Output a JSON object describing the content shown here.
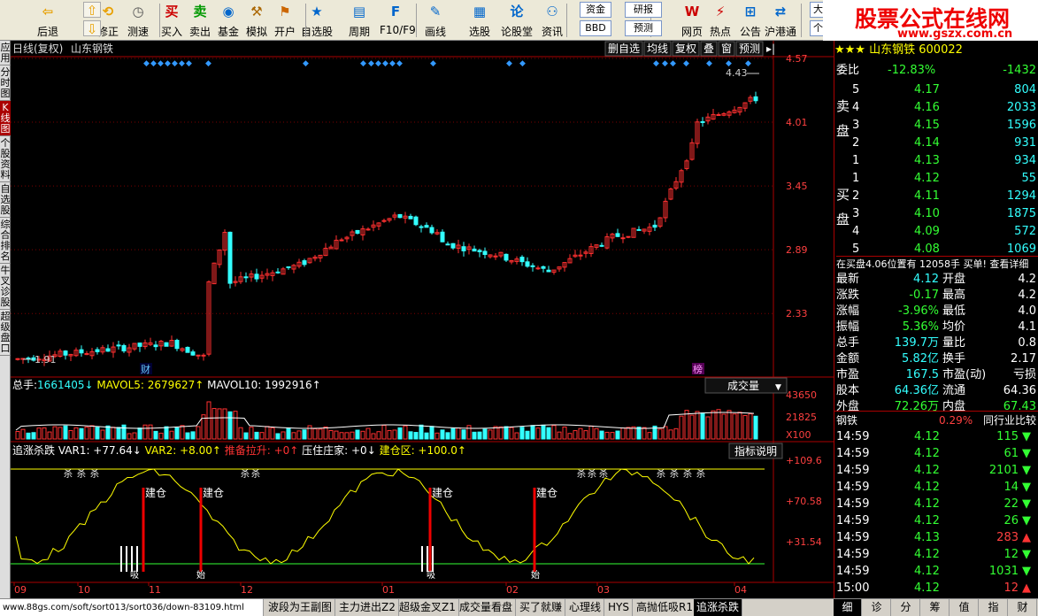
{
  "toolbar": {
    "items": [
      {
        "label": "后退",
        "icon": "back-arrow-icon"
      },
      {
        "label": "修正",
        "icon": "revise-icon"
      },
      {
        "label": "测速",
        "icon": "speed-test-icon"
      },
      {
        "label": "买入",
        "icon": "buy-icon"
      },
      {
        "label": "卖出",
        "icon": "sell-icon"
      },
      {
        "label": "基金",
        "icon": "fund-icon"
      },
      {
        "label": "模拟",
        "icon": "simulate-icon"
      },
      {
        "label": "开户",
        "icon": "open-account-icon"
      },
      {
        "label": "自选股",
        "icon": "watchlist-icon"
      },
      {
        "label": "周期",
        "icon": "period-icon"
      },
      {
        "label": "F10/F9",
        "icon": "f10-icon"
      },
      {
        "label": "画线",
        "icon": "draw-line-icon"
      },
      {
        "label": "选股",
        "icon": "stock-select-icon"
      },
      {
        "label": "论股堂",
        "icon": "forum-icon"
      },
      {
        "label": "资讯",
        "icon": "news-icon"
      },
      {
        "label": "网页",
        "icon": "web-icon"
      },
      {
        "label": "热点",
        "icon": "hotspot-icon"
      },
      {
        "label": "公告",
        "icon": "notice-icon"
      },
      {
        "label": "沪港通",
        "icon": "hk-connect-icon"
      }
    ],
    "zijin": "资金",
    "bbd": "BBD",
    "yanbao": "研报",
    "yuce": "预测",
    "dapan": "大盘",
    "gaban": "个股"
  },
  "brand": {
    "title": "股票公式在线网",
    "url": "www.gszx.com.cn"
  },
  "left_tabs": [
    "应用",
    "分时图",
    "K线图",
    "个股资料",
    "自选股",
    "综合排名",
    "牛叉诊股",
    "超级盘口"
  ],
  "chart": {
    "header": {
      "period": "日线(复权)",
      "name": "山东钢铁"
    },
    "header_buttons": [
      "删自选",
      "均线",
      "复权",
      "叠",
      "窗",
      "预测"
    ],
    "price_axis": [
      "4.57",
      "4.01",
      "3.45",
      "2.89",
      "2.33"
    ],
    "high_label": "4.43",
    "low_label": "1.91",
    "cai_label": "财",
    "bang_label": "榜",
    "volume": {
      "total_label": "总手:",
      "total": "1661405",
      "mavol5_label": "MAVOL5:",
      "mavol5": "2679627",
      "mavol10_label": "MAVOL10:",
      "mavol10": "1992916",
      "dropdown": "成交量",
      "axis": [
        "43650",
        "21825",
        "X100"
      ]
    },
    "indicator": {
      "name": "追涨杀跌",
      "var1": "VAR1: +77.64",
      "var2": "VAR2: +8.00",
      "jiala": "推备拉升: +0",
      "yazhu": "压住庄家: +0",
      "jiancang": "建仓区: +100.0",
      "button": "指标说明",
      "axis": [
        "+109.6",
        "+70.58",
        "+31.54"
      ],
      "jian_label": "建仓",
      "xi_label": "吸",
      "shi_label": "始",
      "sha_label": "杀"
    },
    "x_axis": [
      "09",
      "10",
      "11",
      "12",
      "01",
      "02",
      "03",
      "04"
    ]
  },
  "right": {
    "title": "山东钢铁",
    "code": "600022",
    "weibi": {
      "label": "委比",
      "pct": "-12.83%",
      "diff": "-1432"
    },
    "sell_label": "卖盘",
    "buy_label": "买盘",
    "sells": [
      {
        "lvl": "5",
        "price": "4.17",
        "vol": "804"
      },
      {
        "lvl": "4",
        "price": "4.16",
        "vol": "2033"
      },
      {
        "lvl": "3",
        "price": "4.15",
        "vol": "1596"
      },
      {
        "lvl": "2",
        "price": "4.14",
        "vol": "931"
      },
      {
        "lvl": "1",
        "price": "4.13",
        "vol": "934"
      }
    ],
    "buys": [
      {
        "lvl": "1",
        "price": "4.12",
        "vol": "55"
      },
      {
        "lvl": "2",
        "price": "4.11",
        "vol": "1294"
      },
      {
        "lvl": "3",
        "price": "4.10",
        "vol": "1875"
      },
      {
        "lvl": "4",
        "price": "4.09",
        "vol": "572"
      },
      {
        "lvl": "5",
        "price": "4.08",
        "vol": "1069"
      }
    ],
    "notice": "在买盘4.06位置有 12058手 买单! 查看详细",
    "stats": [
      [
        "最新",
        "4.12",
        "开盘",
        "4.2"
      ],
      [
        "涨跌",
        "-0.17",
        "最高",
        "4.2"
      ],
      [
        "涨幅",
        "-3.96%",
        "最低",
        "4.0"
      ],
      [
        "振幅",
        "5.36%",
        "均价",
        "4.1"
      ],
      [
        "总手",
        "139.7万",
        "量比",
        "0.8"
      ],
      [
        "金额",
        "5.82亿",
        "换手",
        "2.17"
      ],
      [
        "市盈",
        "167.5",
        "市盈(动)",
        "亏损"
      ],
      [
        "股本",
        "64.36亿",
        "流通",
        "64.36"
      ],
      [
        "外盘",
        "72.26万",
        "内盘",
        "67.43"
      ]
    ],
    "industry": {
      "name": "钢铁",
      "pct": "0.29%",
      "btn": "同行业比较"
    },
    "ticks": [
      {
        "t": "14:59",
        "p": "4.12",
        "v": "115",
        "d": "down"
      },
      {
        "t": "14:59",
        "p": "4.12",
        "v": "61",
        "d": "down"
      },
      {
        "t": "14:59",
        "p": "4.12",
        "v": "2101",
        "d": "down"
      },
      {
        "t": "14:59",
        "p": "4.12",
        "v": "14",
        "d": "down"
      },
      {
        "t": "14:59",
        "p": "4.12",
        "v": "22",
        "d": "down"
      },
      {
        "t": "14:59",
        "p": "4.12",
        "v": "26",
        "d": "down"
      },
      {
        "t": "14:59",
        "p": "4.13",
        "v": "283",
        "d": "up"
      },
      {
        "t": "14:59",
        "p": "4.12",
        "v": "12",
        "d": "down"
      },
      {
        "t": "14:59",
        "p": "4.12",
        "v": "1031",
        "d": "down"
      },
      {
        "t": "15:00",
        "p": "4.12",
        "v": "12",
        "d": "up"
      }
    ],
    "bottom_tabs": [
      "细",
      "诊",
      "分",
      "筹",
      "值",
      "指",
      "财"
    ]
  },
  "bottom": {
    "url": "www.88gs.com/soft/sort013/sort036/down-83109.html",
    "tabs": [
      "波段为王副图",
      "主力进出Z2",
      "超级金叉Z1",
      "成交量看盘",
      "买了就赚",
      "心理线",
      "HYS",
      "高抛低吸R1",
      "追涨杀跌"
    ]
  },
  "colors": {
    "up": "#ff3030",
    "down": "#33ffff",
    "grid": "#7a0000",
    "axis_text": "#ff4040"
  }
}
